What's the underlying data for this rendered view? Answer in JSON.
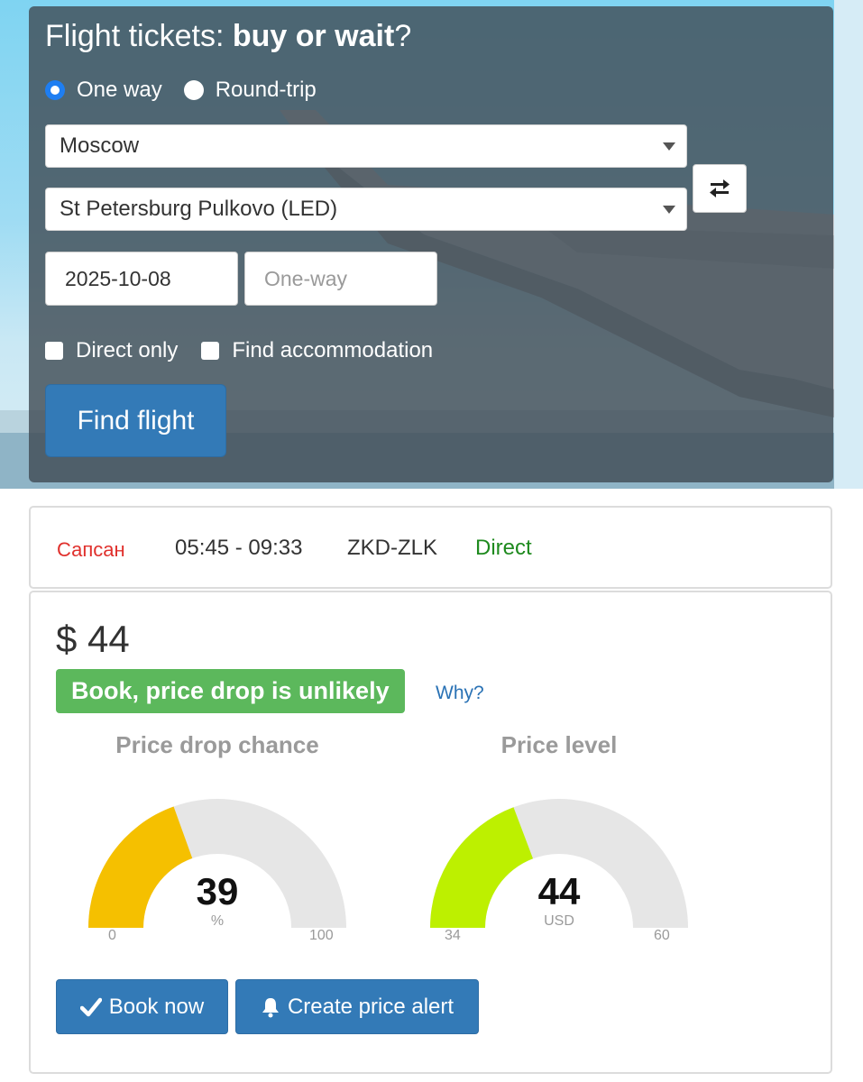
{
  "search": {
    "title_prefix": "Flight tickets: ",
    "title_bold": "buy or wait",
    "title_suffix": "?",
    "trip_types": [
      {
        "label": "One way",
        "selected": true
      },
      {
        "label": "Round-trip",
        "selected": false
      }
    ],
    "origin": "Moscow",
    "destination": "St Petersburg Pulkovo (LED)",
    "depart_date": "2025-10-08",
    "return_placeholder": "One-way",
    "options": [
      {
        "label": "Direct only",
        "checked": false
      },
      {
        "label": "Find accommodation",
        "checked": false
      }
    ],
    "find_label": "Find flight",
    "icons": {
      "swap": "swap-arrows-icon",
      "caret": "chevron-down-icon"
    }
  },
  "result": {
    "carrier": "Сапсан",
    "times": "05:45 - 09:33",
    "codes": "ZKD-ZLK",
    "stops": "Direct",
    "price": "$ 44",
    "recommendation": "Book, price drop is unlikely",
    "why_label": "Why?",
    "gauges": [
      {
        "title": "Price drop chance",
        "value": "39",
        "unit": "%",
        "min": "0",
        "max": "100",
        "fraction": 0.39,
        "color": "#f5c000"
      },
      {
        "title": "Price level",
        "value": "44",
        "unit": "USD",
        "min": "34",
        "max": "60",
        "fraction": 0.385,
        "color": "#bdf000"
      }
    ],
    "book_label": "Book now",
    "alert_label": "Create price alert",
    "icons": {
      "book": "checkmark-icon",
      "alert": "bell-icon"
    }
  },
  "colors": {
    "primary": "#337ab7",
    "success": "#5cb85c",
    "carrier": "#e0302c",
    "direct": "#1e8a1e",
    "link": "#2a72b5"
  }
}
